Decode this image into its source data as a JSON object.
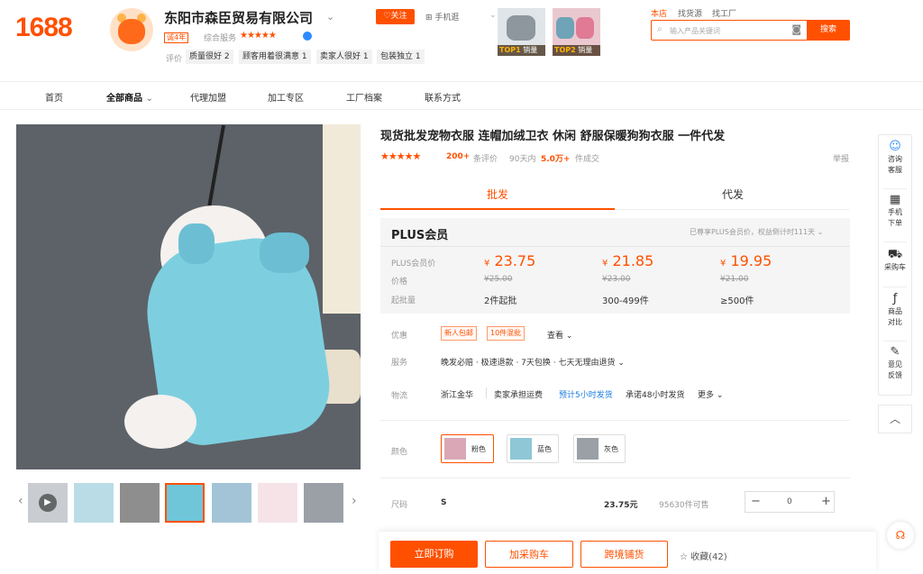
{
  "header": {
    "logo": "1688",
    "shop_name": "东阳市森臣贸易有限公司",
    "years_badge": "诚4年",
    "service_label": "综合服务",
    "service_stars": "★★★★★",
    "eval_label": "评价",
    "eval_tags": [
      "质量很好 2",
      "顾客用着很满意 1",
      "卖家人很好 1",
      "包装独立 1"
    ],
    "follow_label": "♡关注",
    "mobile_label": "⊞ 手机逛",
    "top_items": [
      {
        "rank": "TOP1",
        "label": "销量"
      },
      {
        "rank": "TOP2",
        "label": "销量"
      }
    ],
    "search_scopes": [
      "本店",
      "找货源",
      "找工厂"
    ],
    "search_placeholder": "输入产品关键词",
    "search_button": "搜索"
  },
  "nav": [
    "首页",
    "全部商品",
    "代理加盟",
    "加工专区",
    "工厂档案",
    "联系方式"
  ],
  "product": {
    "title": "现货批发宠物衣服 连帽加绒卫衣 休闲 舒服保暖狗狗衣服 一件代发",
    "stars": "★★★★★",
    "review_count": "200+",
    "review_label": "条评价",
    "sales_prefix": "90天内",
    "sales_value": "5.0万+",
    "sales_suffix": "件成交",
    "report": "举报",
    "tabs": [
      "批发",
      "代发"
    ],
    "plus_title": "PLUS会员",
    "plus_note": "已尊享PLUS会员价，权益倒计时111天 ⌄",
    "price_labels": [
      "PLUS会员价",
      "价格",
      "起批量"
    ],
    "tiers": [
      {
        "plus": "23.75",
        "price": "¥25.00",
        "min": "2件起批"
      },
      {
        "plus": "21.85",
        "price": "¥23.00",
        "min": "300-499件"
      },
      {
        "plus": "19.95",
        "price": "¥21.00",
        "min": "≥500件"
      }
    ],
    "currency": "¥",
    "promo_label": "优惠",
    "promo_tags": [
      "新人包邮",
      "10件混批"
    ],
    "promo_more": "查看 ⌄",
    "service_label": "服务",
    "service_text": "晚发必赔 · 极速退款 · 7天包换 · 七天无理由退货 ⌄",
    "logistics_label": "物流",
    "logistics_from": "浙江金华",
    "logistics_fee": "卖家承担运费",
    "logistics_ship": "预计5小时发货",
    "logistics_promise": "承诺48小时发货",
    "logistics_more": "更多 ⌄",
    "color_label": "颜色",
    "colors": [
      "粉色",
      "蓝色",
      "灰色"
    ],
    "size_label": "尺码",
    "size_value": "S",
    "size_price": "23.75元",
    "size_stock": "95630件可售",
    "quantity": "0",
    "buy_now": "立即订购",
    "add_cart": "加采购车",
    "cross_border": "跨境铺货",
    "favorite": "☆ 收藏(42)"
  },
  "sidebar": [
    {
      "icon": "chat-icon",
      "glyph": "☺",
      "label": "咨询\n客服"
    },
    {
      "icon": "qrcode-icon",
      "glyph": "▦",
      "label": "手机\n下单"
    },
    {
      "icon": "cart-icon",
      "glyph": "⛟",
      "label": "采购车"
    },
    {
      "icon": "compare-icon",
      "glyph": "ƒ",
      "label": "商品\n对比"
    },
    {
      "icon": "feedback-icon",
      "glyph": "✎",
      "label": "意见\n反馈"
    }
  ],
  "colors": {
    "accent": "#ff5000",
    "link": "#1a7de0"
  }
}
